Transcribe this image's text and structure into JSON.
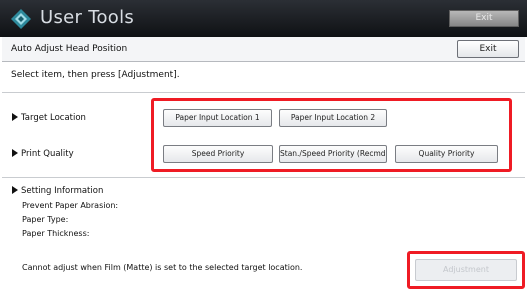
{
  "app": {
    "title": "User Tools",
    "exit_label": "Exit"
  },
  "window": {
    "title": "Auto Adjust Head Position",
    "exit_label": "Exit",
    "instruction": "Select item, then press [Adjustment]."
  },
  "target_location": {
    "label": "Target Location",
    "options": [
      "Paper Input Location 1",
      "Paper Input Location 2"
    ]
  },
  "print_quality": {
    "label": "Print Quality",
    "options": [
      "Speed Priority",
      "Stan./Speed Priority (Recmd.)",
      "Quality Priority"
    ]
  },
  "setting_information": {
    "title": "Setting Information",
    "items": [
      "Prevent Paper Abrasion:",
      "Paper Type:",
      "Paper Thickness:"
    ]
  },
  "notice": "Cannot adjust when Film (Matte) is set to the selected target location.",
  "adjustment_button": {
    "label": "Adjustment",
    "enabled": false
  },
  "colors": {
    "highlight": "#ef1b24",
    "titlebar": "#1a1d21",
    "disabled_text": "#c4c7cc"
  }
}
